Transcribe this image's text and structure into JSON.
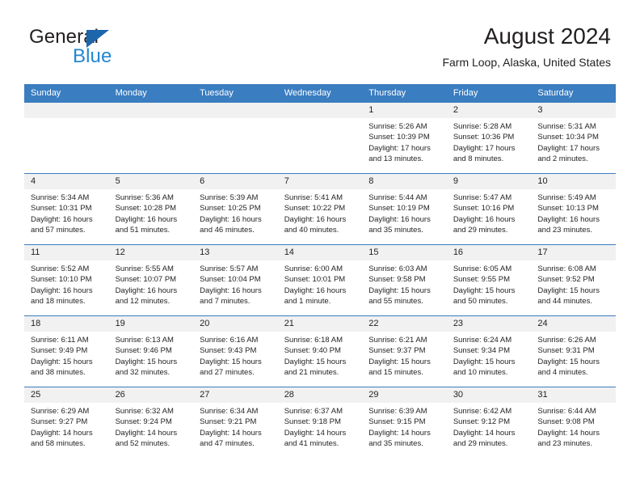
{
  "brand": {
    "word_one": "General",
    "word_two": "Blue",
    "triangle_icon": "triangle-icon",
    "color_dark": "#231f20",
    "color_blue": "#2387d1",
    "color_triangle": "#1d66ab"
  },
  "header": {
    "title": "August 2024",
    "subtitle": "Farm Loop, Alaska, United States"
  },
  "calendar": {
    "accent_color": "#3a7dc0",
    "daynum_band_color": "#f1f1f1",
    "weekday_headers": [
      "Sunday",
      "Monday",
      "Tuesday",
      "Wednesday",
      "Thursday",
      "Friday",
      "Saturday"
    ],
    "weeks": [
      [
        {
          "day": "",
          "empty": true,
          "sunrise": "",
          "sunset": "",
          "daylight_1": "",
          "daylight_2": ""
        },
        {
          "day": "",
          "empty": true,
          "sunrise": "",
          "sunset": "",
          "daylight_1": "",
          "daylight_2": ""
        },
        {
          "day": "",
          "empty": true,
          "sunrise": "",
          "sunset": "",
          "daylight_1": "",
          "daylight_2": ""
        },
        {
          "day": "",
          "empty": true,
          "sunrise": "",
          "sunset": "",
          "daylight_1": "",
          "daylight_2": ""
        },
        {
          "day": "1",
          "empty": false,
          "sunrise": "Sunrise: 5:26 AM",
          "sunset": "Sunset: 10:39 PM",
          "daylight_1": "Daylight: 17 hours",
          "daylight_2": "and 13 minutes."
        },
        {
          "day": "2",
          "empty": false,
          "sunrise": "Sunrise: 5:28 AM",
          "sunset": "Sunset: 10:36 PM",
          "daylight_1": "Daylight: 17 hours",
          "daylight_2": "and 8 minutes."
        },
        {
          "day": "3",
          "empty": false,
          "sunrise": "Sunrise: 5:31 AM",
          "sunset": "Sunset: 10:34 PM",
          "daylight_1": "Daylight: 17 hours",
          "daylight_2": "and 2 minutes."
        }
      ],
      [
        {
          "day": "4",
          "empty": false,
          "sunrise": "Sunrise: 5:34 AM",
          "sunset": "Sunset: 10:31 PM",
          "daylight_1": "Daylight: 16 hours",
          "daylight_2": "and 57 minutes."
        },
        {
          "day": "5",
          "empty": false,
          "sunrise": "Sunrise: 5:36 AM",
          "sunset": "Sunset: 10:28 PM",
          "daylight_1": "Daylight: 16 hours",
          "daylight_2": "and 51 minutes."
        },
        {
          "day": "6",
          "empty": false,
          "sunrise": "Sunrise: 5:39 AM",
          "sunset": "Sunset: 10:25 PM",
          "daylight_1": "Daylight: 16 hours",
          "daylight_2": "and 46 minutes."
        },
        {
          "day": "7",
          "empty": false,
          "sunrise": "Sunrise: 5:41 AM",
          "sunset": "Sunset: 10:22 PM",
          "daylight_1": "Daylight: 16 hours",
          "daylight_2": "and 40 minutes."
        },
        {
          "day": "8",
          "empty": false,
          "sunrise": "Sunrise: 5:44 AM",
          "sunset": "Sunset: 10:19 PM",
          "daylight_1": "Daylight: 16 hours",
          "daylight_2": "and 35 minutes."
        },
        {
          "day": "9",
          "empty": false,
          "sunrise": "Sunrise: 5:47 AM",
          "sunset": "Sunset: 10:16 PM",
          "daylight_1": "Daylight: 16 hours",
          "daylight_2": "and 29 minutes."
        },
        {
          "day": "10",
          "empty": false,
          "sunrise": "Sunrise: 5:49 AM",
          "sunset": "Sunset: 10:13 PM",
          "daylight_1": "Daylight: 16 hours",
          "daylight_2": "and 23 minutes."
        }
      ],
      [
        {
          "day": "11",
          "empty": false,
          "sunrise": "Sunrise: 5:52 AM",
          "sunset": "Sunset: 10:10 PM",
          "daylight_1": "Daylight: 16 hours",
          "daylight_2": "and 18 minutes."
        },
        {
          "day": "12",
          "empty": false,
          "sunrise": "Sunrise: 5:55 AM",
          "sunset": "Sunset: 10:07 PM",
          "daylight_1": "Daylight: 16 hours",
          "daylight_2": "and 12 minutes."
        },
        {
          "day": "13",
          "empty": false,
          "sunrise": "Sunrise: 5:57 AM",
          "sunset": "Sunset: 10:04 PM",
          "daylight_1": "Daylight: 16 hours",
          "daylight_2": "and 7 minutes."
        },
        {
          "day": "14",
          "empty": false,
          "sunrise": "Sunrise: 6:00 AM",
          "sunset": "Sunset: 10:01 PM",
          "daylight_1": "Daylight: 16 hours",
          "daylight_2": "and 1 minute."
        },
        {
          "day": "15",
          "empty": false,
          "sunrise": "Sunrise: 6:03 AM",
          "sunset": "Sunset: 9:58 PM",
          "daylight_1": "Daylight: 15 hours",
          "daylight_2": "and 55 minutes."
        },
        {
          "day": "16",
          "empty": false,
          "sunrise": "Sunrise: 6:05 AM",
          "sunset": "Sunset: 9:55 PM",
          "daylight_1": "Daylight: 15 hours",
          "daylight_2": "and 50 minutes."
        },
        {
          "day": "17",
          "empty": false,
          "sunrise": "Sunrise: 6:08 AM",
          "sunset": "Sunset: 9:52 PM",
          "daylight_1": "Daylight: 15 hours",
          "daylight_2": "and 44 minutes."
        }
      ],
      [
        {
          "day": "18",
          "empty": false,
          "sunrise": "Sunrise: 6:11 AM",
          "sunset": "Sunset: 9:49 PM",
          "daylight_1": "Daylight: 15 hours",
          "daylight_2": "and 38 minutes."
        },
        {
          "day": "19",
          "empty": false,
          "sunrise": "Sunrise: 6:13 AM",
          "sunset": "Sunset: 9:46 PM",
          "daylight_1": "Daylight: 15 hours",
          "daylight_2": "and 32 minutes."
        },
        {
          "day": "20",
          "empty": false,
          "sunrise": "Sunrise: 6:16 AM",
          "sunset": "Sunset: 9:43 PM",
          "daylight_1": "Daylight: 15 hours",
          "daylight_2": "and 27 minutes."
        },
        {
          "day": "21",
          "empty": false,
          "sunrise": "Sunrise: 6:18 AM",
          "sunset": "Sunset: 9:40 PM",
          "daylight_1": "Daylight: 15 hours",
          "daylight_2": "and 21 minutes."
        },
        {
          "day": "22",
          "empty": false,
          "sunrise": "Sunrise: 6:21 AM",
          "sunset": "Sunset: 9:37 PM",
          "daylight_1": "Daylight: 15 hours",
          "daylight_2": "and 15 minutes."
        },
        {
          "day": "23",
          "empty": false,
          "sunrise": "Sunrise: 6:24 AM",
          "sunset": "Sunset: 9:34 PM",
          "daylight_1": "Daylight: 15 hours",
          "daylight_2": "and 10 minutes."
        },
        {
          "day": "24",
          "empty": false,
          "sunrise": "Sunrise: 6:26 AM",
          "sunset": "Sunset: 9:31 PM",
          "daylight_1": "Daylight: 15 hours",
          "daylight_2": "and 4 minutes."
        }
      ],
      [
        {
          "day": "25",
          "empty": false,
          "sunrise": "Sunrise: 6:29 AM",
          "sunset": "Sunset: 9:27 PM",
          "daylight_1": "Daylight: 14 hours",
          "daylight_2": "and 58 minutes."
        },
        {
          "day": "26",
          "empty": false,
          "sunrise": "Sunrise: 6:32 AM",
          "sunset": "Sunset: 9:24 PM",
          "daylight_1": "Daylight: 14 hours",
          "daylight_2": "and 52 minutes."
        },
        {
          "day": "27",
          "empty": false,
          "sunrise": "Sunrise: 6:34 AM",
          "sunset": "Sunset: 9:21 PM",
          "daylight_1": "Daylight: 14 hours",
          "daylight_2": "and 47 minutes."
        },
        {
          "day": "28",
          "empty": false,
          "sunrise": "Sunrise: 6:37 AM",
          "sunset": "Sunset: 9:18 PM",
          "daylight_1": "Daylight: 14 hours",
          "daylight_2": "and 41 minutes."
        },
        {
          "day": "29",
          "empty": false,
          "sunrise": "Sunrise: 6:39 AM",
          "sunset": "Sunset: 9:15 PM",
          "daylight_1": "Daylight: 14 hours",
          "daylight_2": "and 35 minutes."
        },
        {
          "day": "30",
          "empty": false,
          "sunrise": "Sunrise: 6:42 AM",
          "sunset": "Sunset: 9:12 PM",
          "daylight_1": "Daylight: 14 hours",
          "daylight_2": "and 29 minutes."
        },
        {
          "day": "31",
          "empty": false,
          "sunrise": "Sunrise: 6:44 AM",
          "sunset": "Sunset: 9:08 PM",
          "daylight_1": "Daylight: 14 hours",
          "daylight_2": "and 23 minutes."
        }
      ]
    ]
  }
}
